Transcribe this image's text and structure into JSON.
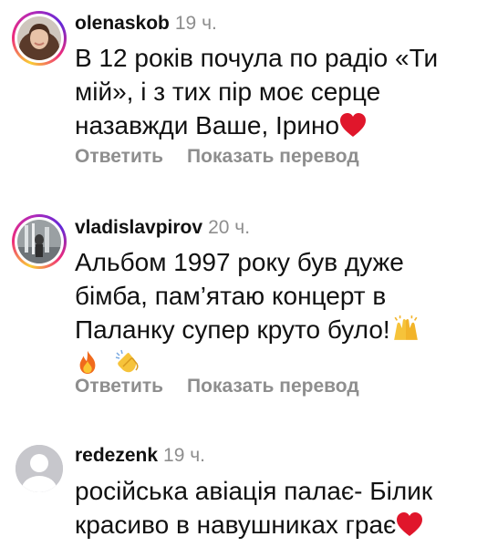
{
  "comments": [
    {
      "username": "olenaskob",
      "time": "19 ч.",
      "text": "В 12 років почула по радіо «Ти мій», і з тих пір моє серце назавжди Ваше, Ірино",
      "reply_label": "Ответить",
      "translate_label": "Показать перевод"
    },
    {
      "username": "vladislavpirov",
      "time": "20 ч.",
      "text": "Альбом 1997 року був дуже бімба, пам’ятаю концерт в Паланку супер круто було!",
      "emoji_tail": "🔥 👏",
      "reply_label": "Ответить",
      "translate_label": "Показать перевод"
    },
    {
      "username": "redezenk",
      "time": "19 ч.",
      "text": "російська авіація палає- Білик красиво в навушниках грає",
      "reply_label": "",
      "translate_label": ""
    }
  ],
  "colors": {
    "text": "#111111",
    "muted": "#8e8e8e",
    "heart": "#e0162b"
  },
  "icons": [
    "heart-emoji-icon",
    "raising-hands-emoji-icon",
    "fire-emoji-icon",
    "clapping-hands-emoji-icon",
    "default-avatar-icon"
  ]
}
